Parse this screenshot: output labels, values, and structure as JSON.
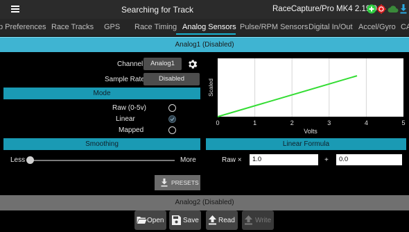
{
  "titlebar": {
    "menu_icon": "hamburger-menu-icon",
    "status": "Searching for Track",
    "device": "RaceCapture/Pro MK4 2.19.0",
    "icons": [
      "add-icon",
      "target-icon",
      "cloud-icon",
      "download-icon"
    ],
    "icon_colors": {
      "add": "#2ecc40",
      "target": "#e02020",
      "cloud": "#3a8a3a",
      "download": "#2aa8e0"
    }
  },
  "tabs": [
    {
      "label": "p Preferences"
    },
    {
      "label": "Race Tracks"
    },
    {
      "label": "GPS"
    },
    {
      "label": "Race Timing"
    },
    {
      "label": "Analog Sensors"
    },
    {
      "label": "Pulse/RPM Sensors"
    },
    {
      "label": "Digital In/Out"
    },
    {
      "label": "Accel/Gyro"
    },
    {
      "label": "CA"
    }
  ],
  "active_tab": "Analog Sensors",
  "channel_panel": {
    "header": "Analog1 (Disabled)",
    "channel_label": "Channel",
    "channel_value": "Analog1",
    "settings_icon": "gear-icon",
    "sample_rate_label": "Sample Rate",
    "sample_rate_value": "Disabled"
  },
  "mode": {
    "title": "Mode",
    "options": [
      {
        "label": "Raw (0-5v)",
        "checked": false
      },
      {
        "label": "Linear",
        "checked": true
      },
      {
        "label": "Mapped",
        "checked": false
      }
    ]
  },
  "smoothing": {
    "title": "Smoothing",
    "less": "Less",
    "more": "More",
    "value": 0
  },
  "linear_formula": {
    "title": "Linear Formula",
    "raw_label": "Raw ×",
    "multiplier": "1.0",
    "plus": "+",
    "offset": "0.0"
  },
  "presets_label": "PRESETS",
  "chart_data": {
    "type": "line",
    "xlabel": "Volts",
    "ylabel": "Scaled",
    "xlim": [
      0,
      5
    ],
    "x_ticks": [
      "0",
      "1",
      "2",
      "3",
      "4",
      "5"
    ],
    "grid": true,
    "series": [
      {
        "color": "#33dd33",
        "x": [
          0,
          3.75
        ],
        "y": [
          0,
          3.75
        ]
      }
    ]
  },
  "footer_panel": {
    "header": "Analog2 (Disabled)"
  },
  "toolbar": {
    "open": "Open",
    "save": "Save",
    "read": "Read",
    "write": "Write"
  }
}
